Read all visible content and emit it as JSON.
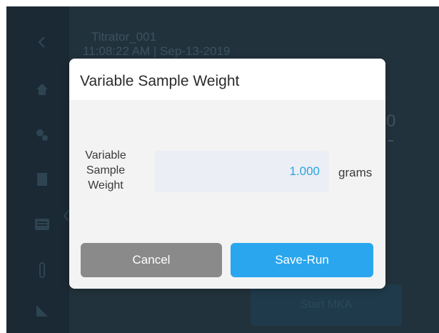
{
  "background": {
    "device_title": "Titrator_001",
    "timestamp": "11:08:22 AM | Sep-13-2019",
    "partial_digit": "0",
    "start_button_label": "Start MKA",
    "nav_icons": [
      "back-arrow-icon",
      "home-icon",
      "settings-icon",
      "document-icon",
      "stack-icon",
      "probe-icon",
      "chart-icon"
    ]
  },
  "dialog": {
    "title": "Variable Sample Weight",
    "field_label_lines": [
      "Variable",
      "Sample",
      "Weight"
    ],
    "field_value": "1.000",
    "unit": "grams",
    "cancel_label": "Cancel",
    "save_label": "Save-Run"
  },
  "colors": {
    "overlay_bg": "#22323c",
    "sidebar_bg": "#1b2934",
    "accent": "#2aa6ee",
    "cancel_gray": "#8a8a8a",
    "value_blue": "#2fa3e0"
  }
}
